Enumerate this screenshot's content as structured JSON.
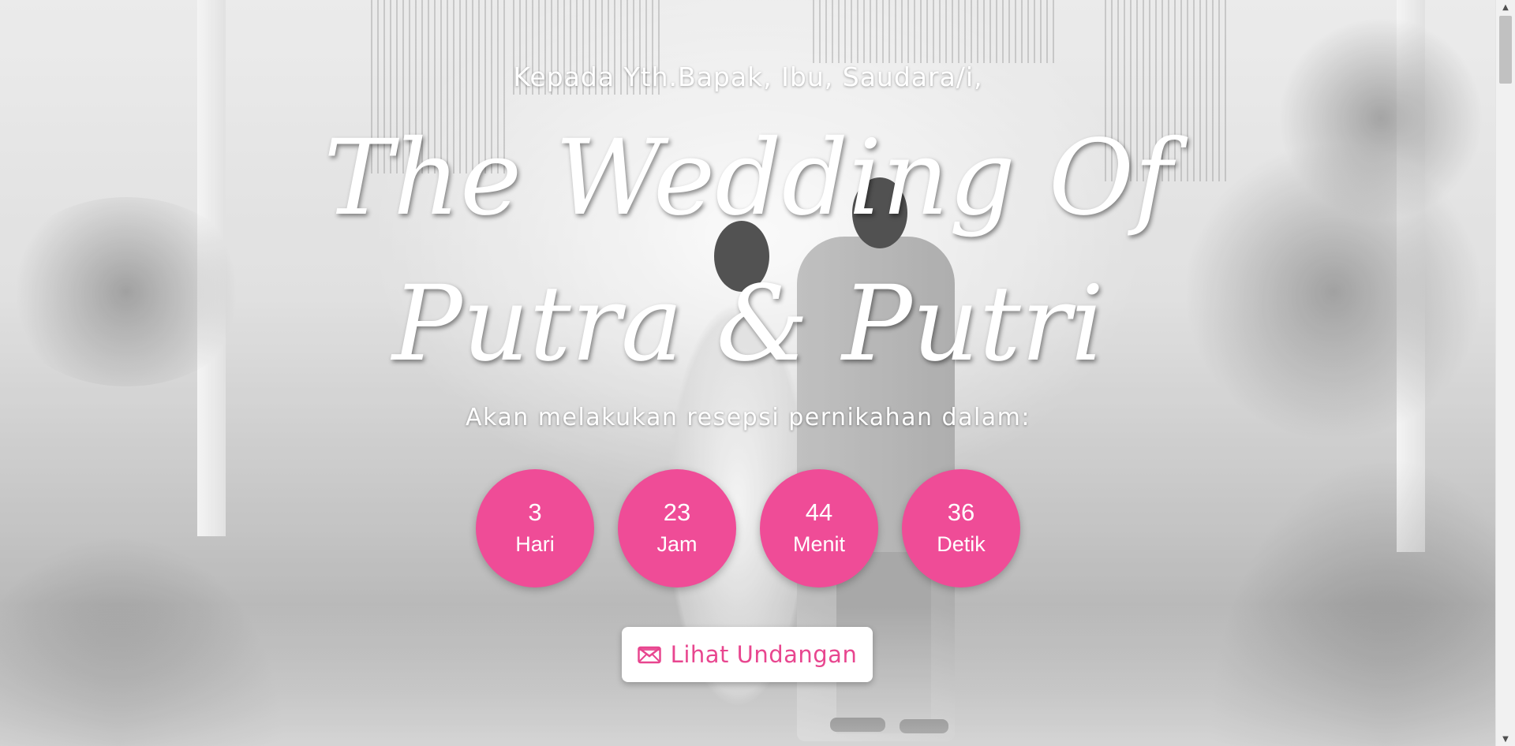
{
  "hero": {
    "greeting": "Kepada Yth.Bapak, Ibu, Saudara/i,",
    "title_line1": "The Wedding Of",
    "title_line2": "Putra & Putri",
    "subtitle": "Akan melakukan resepsi pernikahan dalam:"
  },
  "countdown": [
    {
      "value": "3",
      "unit": "Hari"
    },
    {
      "value": "23",
      "unit": "Jam"
    },
    {
      "value": "44",
      "unit": "Menit"
    },
    {
      "value": "36",
      "unit": "Detik"
    }
  ],
  "cta": {
    "label": "Lihat Undangan",
    "icon": "envelope-open-icon"
  },
  "colors": {
    "accent": "#ef4c97",
    "cta_text": "#e8468f"
  }
}
